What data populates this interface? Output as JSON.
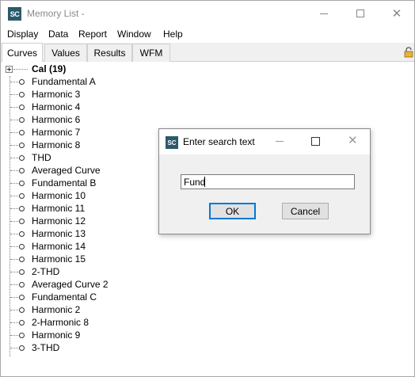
{
  "window": {
    "title": "Memory List -",
    "app_icon_text": "SC"
  },
  "menu": [
    "Display",
    "Data",
    "Report",
    "Window",
    "Help"
  ],
  "tabs": [
    {
      "label": "Curves",
      "active": true
    },
    {
      "label": "Values",
      "active": false
    },
    {
      "label": "Results",
      "active": false
    },
    {
      "label": "WFM",
      "active": false
    }
  ],
  "tree": {
    "root_label": "Cal (19)",
    "items": [
      "Fundamental A",
      "Harmonic 3",
      "Harmonic 4",
      "Harmonic 6",
      "Harmonic 7",
      "Harmonic 8",
      "THD",
      "Averaged Curve",
      "Fundamental B",
      "Harmonic 10",
      "Harmonic 11",
      "Harmonic 12",
      "Harmonic 13",
      "Harmonic 14",
      "Harmonic 15",
      "2-THD",
      "Averaged Curve 2",
      "Fundamental C",
      "Harmonic 2",
      "2-Harmonic 8",
      "Harmonic 9",
      "3-THD"
    ]
  },
  "dialog": {
    "title": "Enter search text",
    "icon_text": "SC",
    "input_value": "Fund",
    "ok_label": "OK",
    "cancel_label": "Cancel"
  },
  "colors": {
    "app_icon": "#2b5a6b",
    "focus_border": "#0078d7",
    "dialog_bg": "#f0f0f0"
  }
}
